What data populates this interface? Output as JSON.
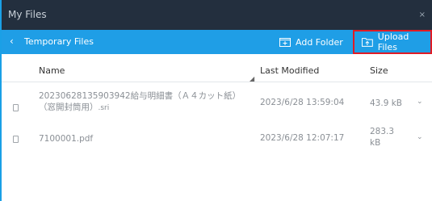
{
  "window": {
    "title": "My Files",
    "close_glyph": "×"
  },
  "nav": {
    "back_glyph": "‹",
    "breadcrumb": "Temporary Files",
    "add_folder_label": "Add Folder",
    "upload_label": "Upload Files",
    "add_folder_icon": "folder-plus-icon",
    "upload_icon": "folder-upload-icon"
  },
  "table": {
    "columns": {
      "name": "Name",
      "modified": "Last Modified",
      "size": "Size"
    },
    "rows": [
      {
        "name_line1": "20230628135903942給与明細書（Ａ４カット紙）",
        "name_line2": "（窓開封筒用）",
        "ext": ".sri",
        "modified": "2023/6/28 13:59:04",
        "size_line1": "43.9 kB",
        "size_line2": "",
        "chevron": "⌄"
      },
      {
        "name_line1": "7100001.pdf",
        "name_line2": "",
        "ext": "",
        "modified": "2023/6/28 12:07:17",
        "size_line1": "283.3",
        "size_line2": "kB",
        "chevron": "⌄"
      }
    ]
  },
  "colors": {
    "titlebar": "#232f3e",
    "navbar": "#1f9ee6",
    "highlight": "#e01b25"
  }
}
